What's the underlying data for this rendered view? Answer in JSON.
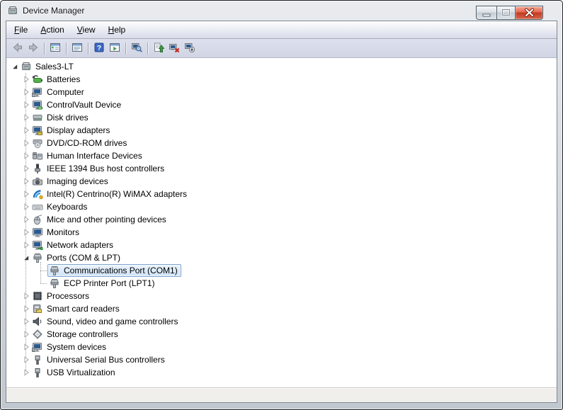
{
  "window": {
    "title": "Device Manager",
    "icon": "device-manager-icon",
    "controls": [
      {
        "name": "minimize",
        "glyph": "minimize"
      },
      {
        "name": "maximize",
        "glyph": "maximize"
      },
      {
        "name": "close",
        "glyph": "close"
      }
    ]
  },
  "menubar": {
    "items": [
      {
        "label": "File",
        "underline": 0
      },
      {
        "label": "Action",
        "underline": 0
      },
      {
        "label": "View",
        "underline": 0
      },
      {
        "label": "Help",
        "underline": 0
      }
    ]
  },
  "toolbar": {
    "groups": [
      {
        "buttons": [
          {
            "name": "back",
            "icon": "arrow-left-icon"
          },
          {
            "name": "forward",
            "icon": "arrow-right-icon"
          }
        ]
      },
      {
        "buttons": [
          {
            "name": "show-hide-console-tree",
            "icon": "console-tree-icon"
          }
        ]
      },
      {
        "buttons": [
          {
            "name": "properties",
            "icon": "properties-window-icon"
          }
        ]
      },
      {
        "buttons": [
          {
            "name": "help",
            "icon": "help-icon"
          },
          {
            "name": "show-action-pane",
            "icon": "action-pane-icon"
          }
        ]
      },
      {
        "buttons": [
          {
            "name": "scan-for-hardware-changes",
            "icon": "scan-computer-icon"
          }
        ]
      },
      {
        "buttons": [
          {
            "name": "update-driver-software",
            "icon": "update-driver-icon"
          },
          {
            "name": "uninstall-device",
            "icon": "uninstall-device-icon"
          },
          {
            "name": "disable-device",
            "icon": "disable-device-icon"
          }
        ]
      }
    ]
  },
  "tree": {
    "items": [
      {
        "label": "Sales3-LT",
        "level": 0,
        "state": "expanded",
        "icon": "computer-root",
        "selected": false
      },
      {
        "label": "Batteries",
        "level": 1,
        "state": "collapsed",
        "icon": "battery",
        "selected": false
      },
      {
        "label": "Computer",
        "level": 1,
        "state": "collapsed",
        "icon": "computer",
        "selected": false
      },
      {
        "label": "ControlVault Device",
        "level": 1,
        "state": "collapsed",
        "icon": "controlvault",
        "selected": false
      },
      {
        "label": "Disk drives",
        "level": 1,
        "state": "collapsed",
        "icon": "disk-drive",
        "selected": false
      },
      {
        "label": "Display adapters",
        "level": 1,
        "state": "collapsed",
        "icon": "display-adapter",
        "selected": false
      },
      {
        "label": "DVD/CD-ROM drives",
        "level": 1,
        "state": "collapsed",
        "icon": "cd-drive",
        "selected": false
      },
      {
        "label": "Human Interface Devices",
        "level": 1,
        "state": "collapsed",
        "icon": "hid-device",
        "selected": false
      },
      {
        "label": "IEEE 1394 Bus host controllers",
        "level": 1,
        "state": "collapsed",
        "icon": "ieee1394",
        "selected": false
      },
      {
        "label": "Imaging devices",
        "level": 1,
        "state": "collapsed",
        "icon": "imaging-device",
        "selected": false
      },
      {
        "label": "Intel(R) Centrino(R) WiMAX adapters",
        "level": 1,
        "state": "collapsed",
        "icon": "wimax-adapter",
        "selected": false
      },
      {
        "label": "Keyboards",
        "level": 1,
        "state": "collapsed",
        "icon": "keyboard",
        "selected": false
      },
      {
        "label": "Mice and other pointing devices",
        "level": 1,
        "state": "collapsed",
        "icon": "mouse",
        "selected": false
      },
      {
        "label": "Monitors",
        "level": 1,
        "state": "collapsed",
        "icon": "monitor",
        "selected": false
      },
      {
        "label": "Network adapters",
        "level": 1,
        "state": "collapsed",
        "icon": "network-adapter",
        "selected": false
      },
      {
        "label": "Ports (COM & LPT)",
        "level": 1,
        "state": "expanded",
        "icon": "port",
        "selected": false
      },
      {
        "label": "Communications Port (COM1)",
        "level": 2,
        "state": "none",
        "icon": "port",
        "selected": true
      },
      {
        "label": "ECP Printer Port (LPT1)",
        "level": 2,
        "state": "none",
        "icon": "port",
        "selected": false
      },
      {
        "label": "Processors",
        "level": 1,
        "state": "collapsed",
        "icon": "processor",
        "selected": false
      },
      {
        "label": "Smart card readers",
        "level": 1,
        "state": "collapsed",
        "icon": "smartcard-reader",
        "selected": false
      },
      {
        "label": "Sound, video and game controllers",
        "level": 1,
        "state": "collapsed",
        "icon": "sound",
        "selected": false
      },
      {
        "label": "Storage controllers",
        "level": 1,
        "state": "collapsed",
        "icon": "storage-controller",
        "selected": false
      },
      {
        "label": "System devices",
        "level": 1,
        "state": "collapsed",
        "icon": "system-device",
        "selected": false
      },
      {
        "label": "Universal Serial Bus controllers",
        "level": 1,
        "state": "collapsed",
        "icon": "usb-controller",
        "selected": false
      },
      {
        "label": "USB Virtualization",
        "level": 1,
        "state": "collapsed",
        "icon": "usb-controller",
        "selected": false
      }
    ]
  },
  "statusbar": {
    "text": ""
  },
  "colors": {
    "selection_border": "#7DA2CE",
    "selection_fill_top": "#EBF4FC",
    "selection_fill_bottom": "#D1E4F7",
    "help_button_blue": "#3B67C5",
    "close_button_red": "#C13A21",
    "menubar_lavender": "#D8DCEA",
    "statusbar_gray": "#F1EFEC"
  }
}
